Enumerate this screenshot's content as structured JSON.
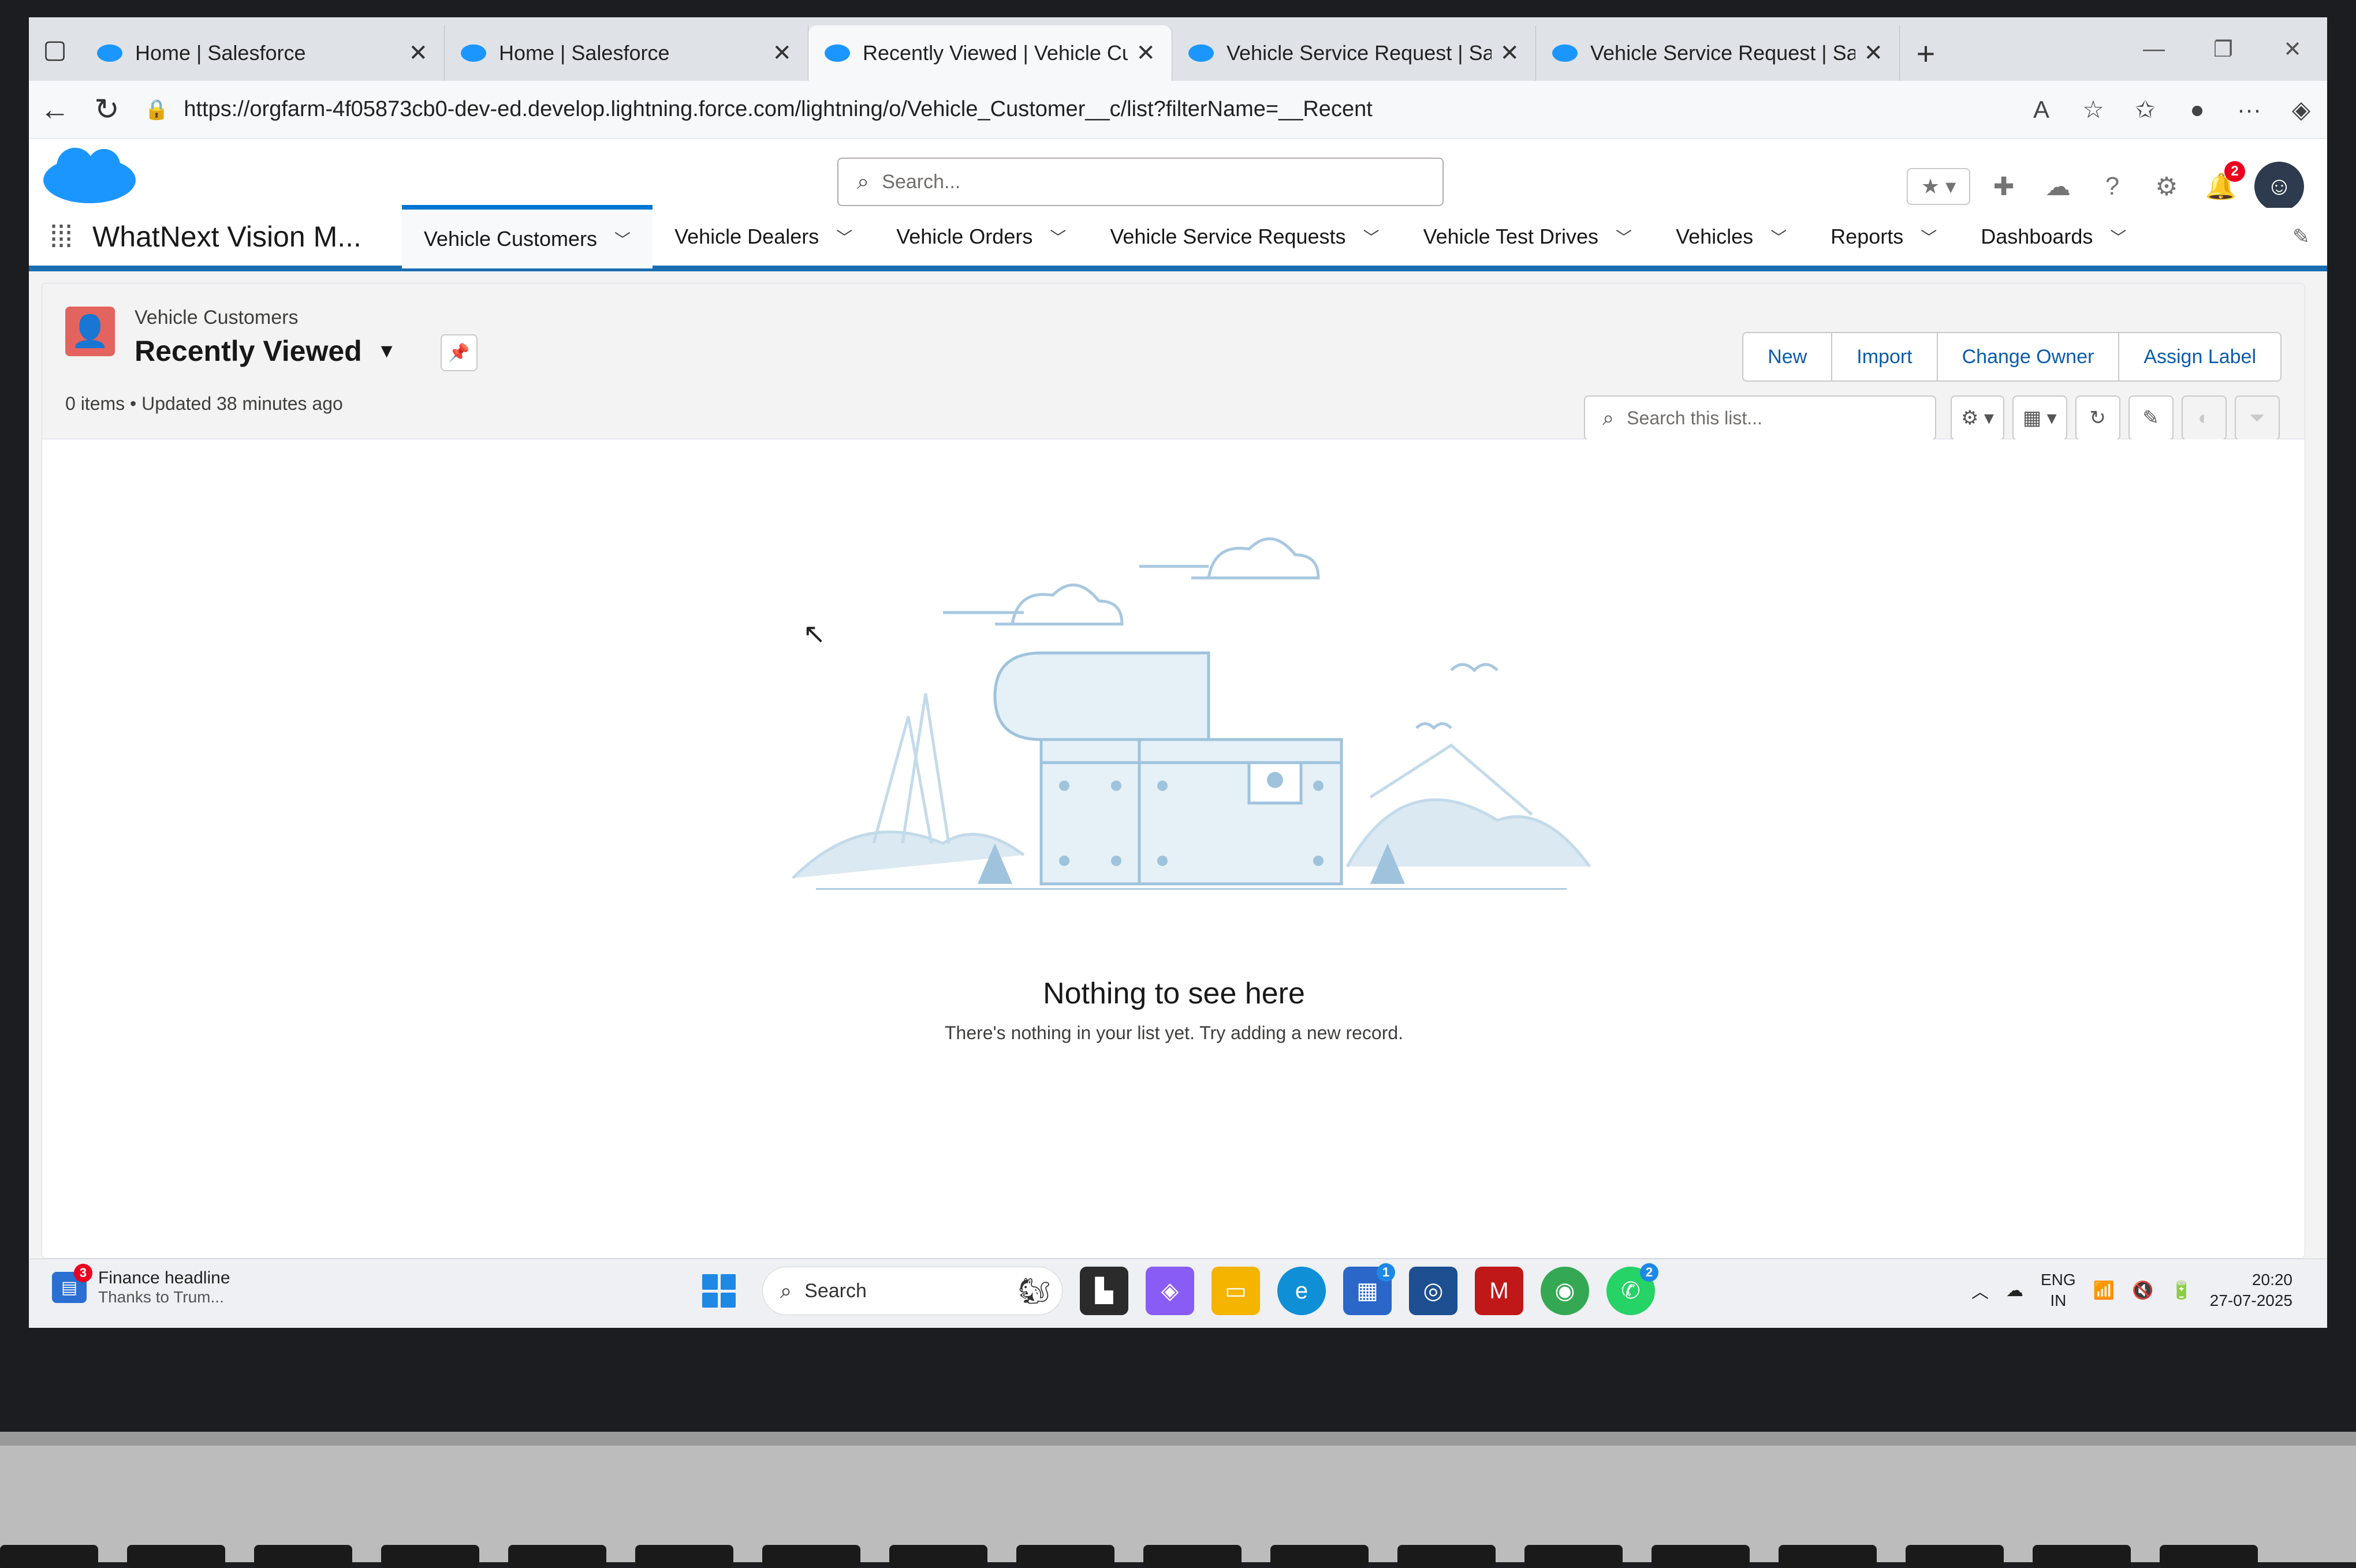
{
  "browser": {
    "tabs": [
      {
        "title": "Home | Salesforce",
        "active": false
      },
      {
        "title": "Home | Salesforce",
        "active": false
      },
      {
        "title": "Recently Viewed | Vehicle Custom",
        "active": true
      },
      {
        "title": "Vehicle Service Request | Salesfor",
        "active": false
      },
      {
        "title": "Vehicle Service Request | Salesfor",
        "active": false
      }
    ],
    "close_glyph": "✕",
    "new_tab_glyph": "+",
    "url": "https://orgfarm-4f05873cb0-dev-ed.develop.lightning.force.com/lightning/o/Vehicle_Customer__c/list?filterName=__Recent"
  },
  "header": {
    "search_placeholder": "Search...",
    "notifications_count": "2"
  },
  "nav": {
    "app_name": "WhatNext Vision M...",
    "items": [
      {
        "label": "Vehicle Customers",
        "active": true
      },
      {
        "label": "Vehicle Dealers"
      },
      {
        "label": "Vehicle Orders"
      },
      {
        "label": "Vehicle Service Requests"
      },
      {
        "label": "Vehicle Test Drives"
      },
      {
        "label": "Vehicles"
      },
      {
        "label": "Reports"
      },
      {
        "label": "Dashboards"
      }
    ]
  },
  "list_view": {
    "object_name": "Vehicle Customers",
    "view_name": "Recently Viewed",
    "meta": "0 items • Updated 38 minutes ago",
    "actions": [
      "New",
      "Import",
      "Change Owner",
      "Assign Label"
    ],
    "search_placeholder": "Search this list..."
  },
  "empty_state": {
    "title": "Nothing to see here",
    "subtitle": "There's nothing in your list yet. Try adding a new record."
  },
  "taskbar": {
    "news_badge": "3",
    "news_title": "Finance headline",
    "news_sub": "Thanks to Trum...",
    "search_label": "Search",
    "store_badge": "1",
    "whatsapp_badge": "2",
    "lang_line1": "ENG",
    "lang_line2": "IN",
    "time": "20:20",
    "date": "27-07-2025"
  },
  "colors": {
    "brand_blue": "#0176d3",
    "nav_stripe": "#1b6db2",
    "object_icon": "#e3645f",
    "notification_badge": "#ea001e"
  }
}
